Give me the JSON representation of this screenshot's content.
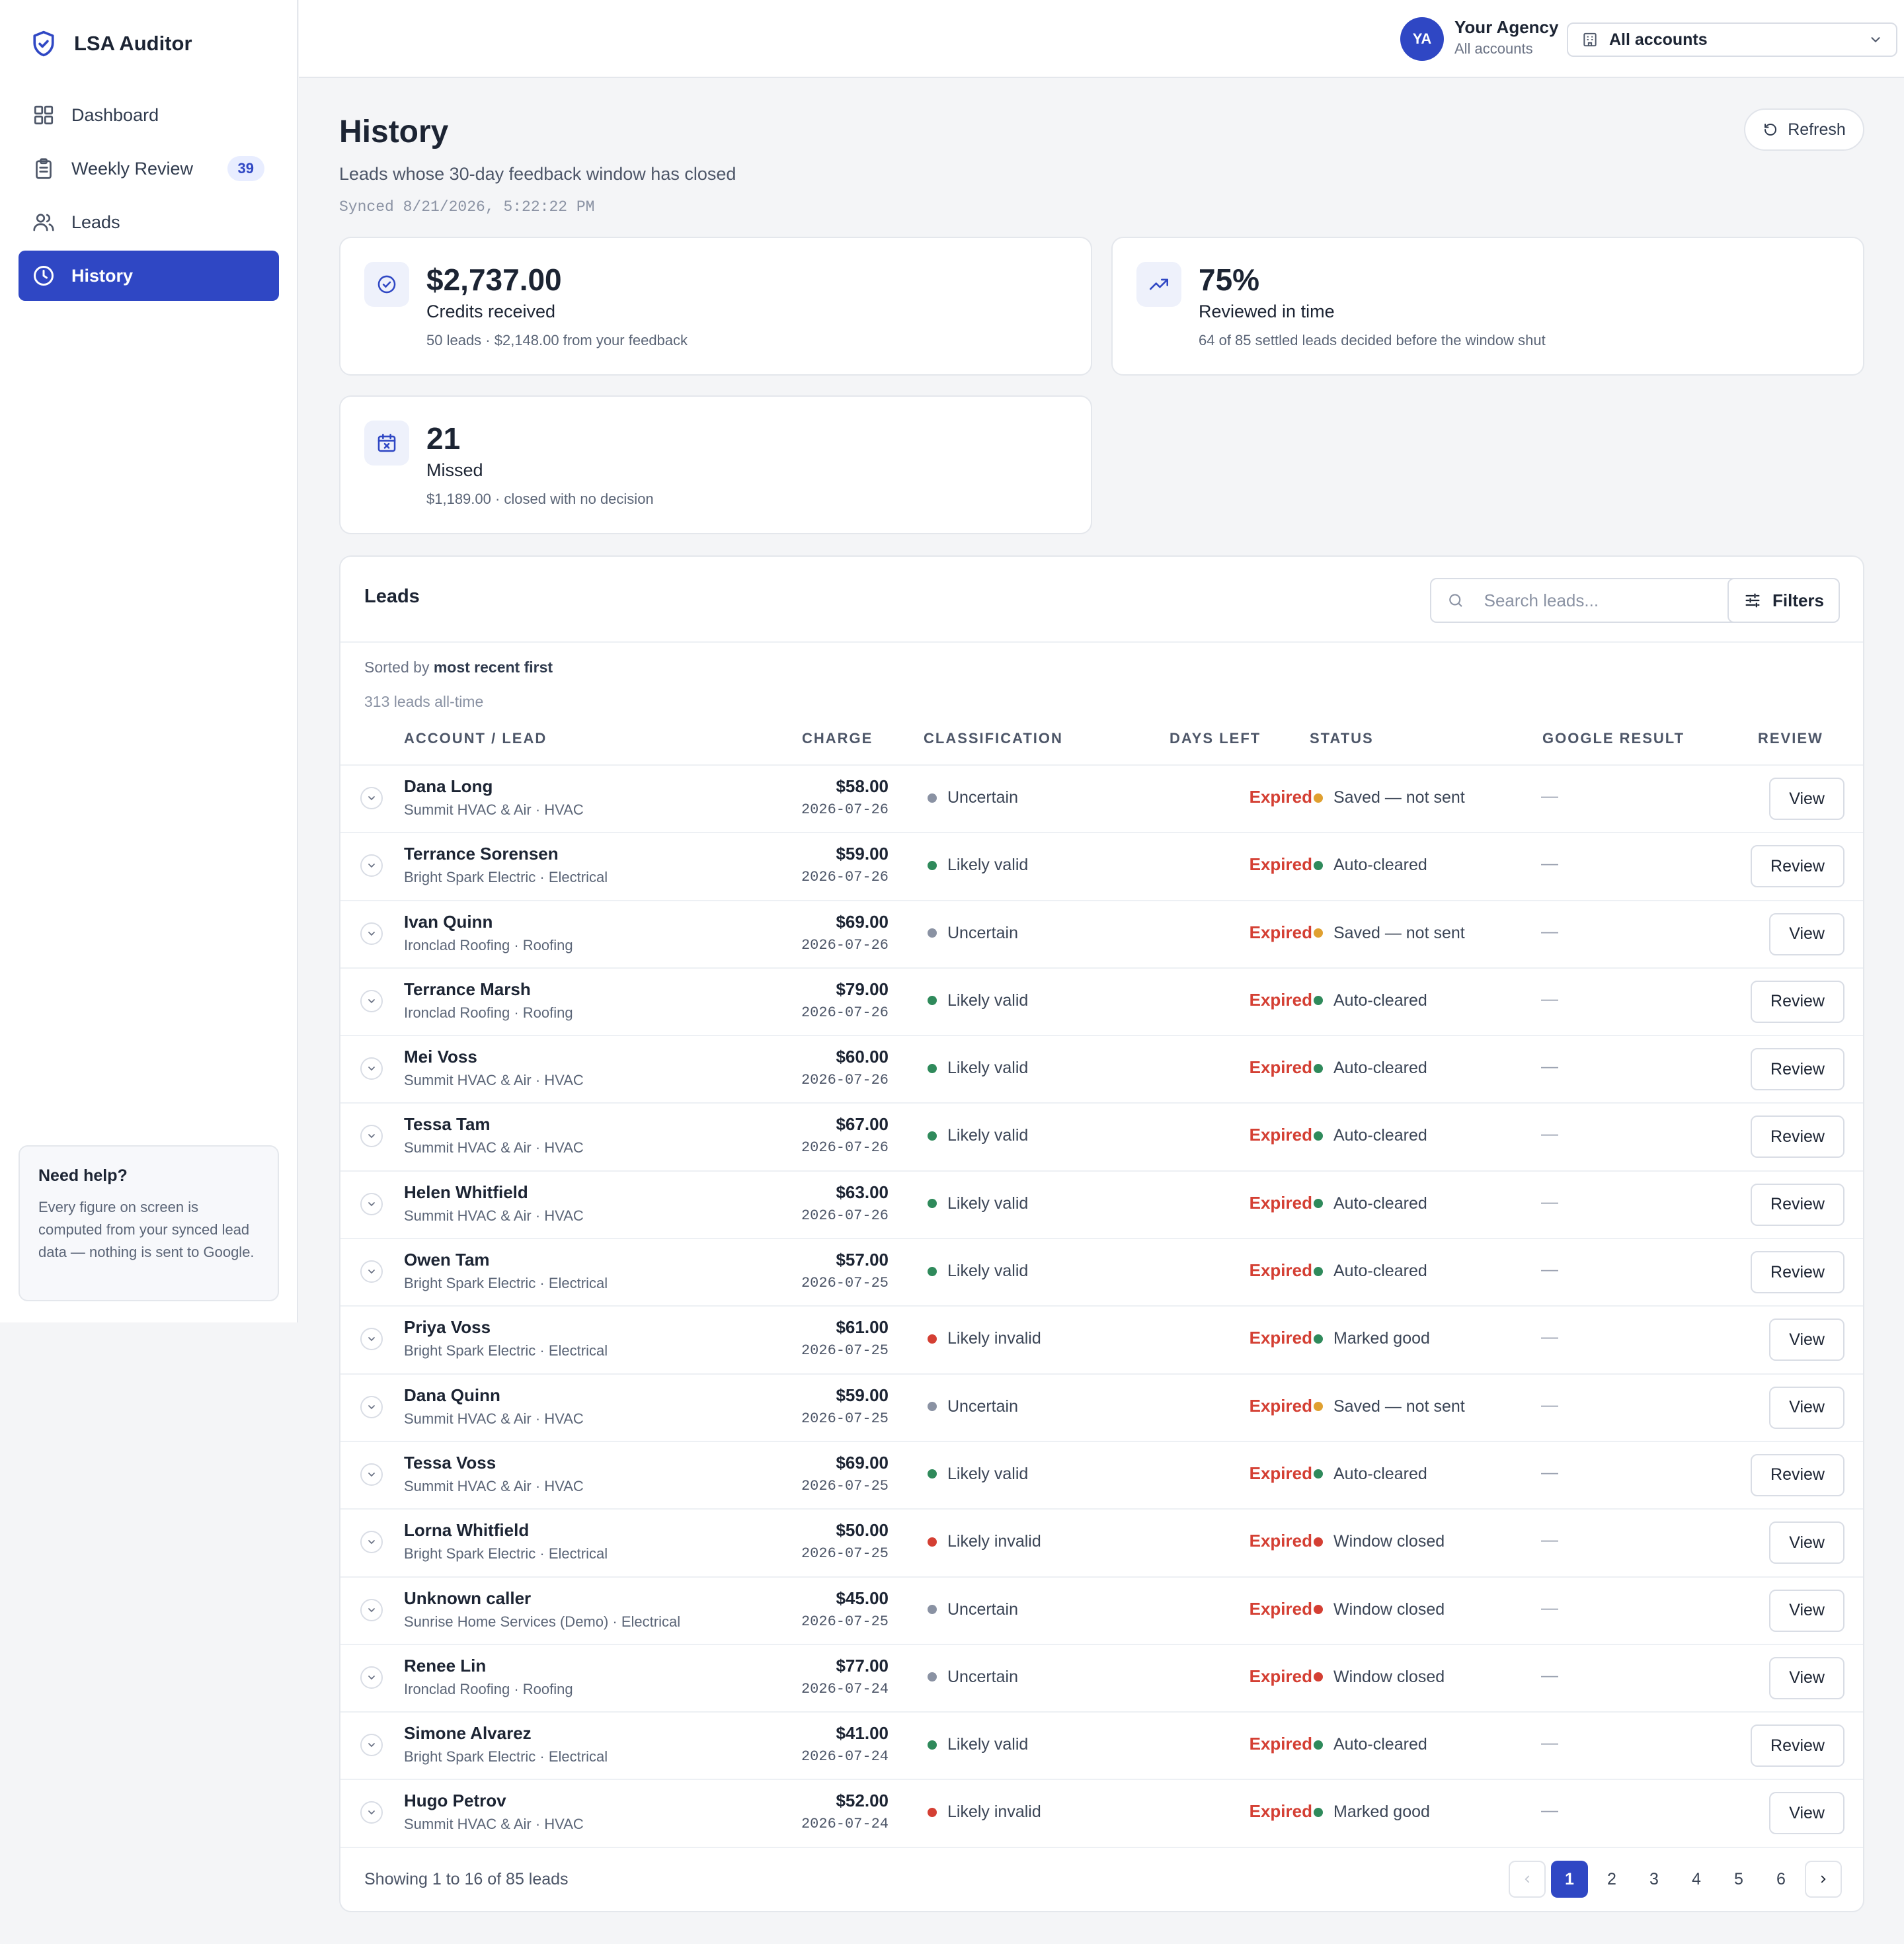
{
  "app": {
    "name": "LSA Auditor"
  },
  "sidebar": {
    "items": [
      {
        "label": "Dashboard",
        "icon": "grid-icon"
      },
      {
        "label": "Weekly Review",
        "icon": "clipboard-icon",
        "badge": "39"
      },
      {
        "label": "Leads",
        "icon": "users-icon"
      },
      {
        "label": "History",
        "icon": "clock-icon",
        "active": true
      }
    ],
    "help": {
      "title": "Need help?",
      "text": "Every figure on screen is computed from your synced lead data — nothing is sent to Google."
    }
  },
  "topbar": {
    "avatar_initials": "YA",
    "agency_name": "Your Agency",
    "agency_scope": "All accounts",
    "account_select": "All accounts"
  },
  "header": {
    "title": "History",
    "subtitle": "Leads whose 30-day feedback window has closed",
    "synced": "Synced 8/21/2026, 5:22:22 PM",
    "refresh_label": "Refresh"
  },
  "stats": [
    {
      "value": "$2,737.00",
      "label": "Credits received",
      "detail": "50 leads · $2,148.00 from your feedback",
      "icon": "check-circle-icon"
    },
    {
      "value": "75%",
      "label": "Reviewed in time",
      "detail": "64 of 85 settled leads decided before the window shut",
      "icon": "trending-up-icon"
    },
    {
      "value": "21",
      "label": "Missed",
      "detail": "$1,189.00 · closed with no decision",
      "icon": "calendar-x-icon"
    }
  ],
  "leads_panel": {
    "title": "Leads",
    "search_placeholder": "Search leads...",
    "filters_label": "Filters",
    "sorted_prefix": "Sorted by",
    "sorted_value": "most recent first",
    "alltime": "313 leads all-time",
    "columns": [
      "ACCOUNT / LEAD",
      "CHARGE",
      "CLASSIFICATION",
      "DAYS LEFT",
      "STATUS",
      "GOOGLE RESULT",
      "REVIEW"
    ],
    "rows": [
      {
        "name": "Dana Long",
        "account": "Summit HVAC & Air · HVAC",
        "charge": "$58.00",
        "date": "2026-07-26",
        "classification": "Uncertain",
        "days_left": "Expired",
        "status": "Saved — not sent",
        "google_result": "—",
        "action": "View"
      },
      {
        "name": "Terrance Sorensen",
        "account": "Bright Spark Electric · Electrical",
        "charge": "$59.00",
        "date": "2026-07-26",
        "classification": "Likely valid",
        "days_left": "Expired",
        "status": "Auto-cleared",
        "google_result": "—",
        "action": "Review"
      },
      {
        "name": "Ivan Quinn",
        "account": "Ironclad Roofing · Roofing",
        "charge": "$69.00",
        "date": "2026-07-26",
        "classification": "Uncertain",
        "days_left": "Expired",
        "status": "Saved — not sent",
        "google_result": "—",
        "action": "View"
      },
      {
        "name": "Terrance Marsh",
        "account": "Ironclad Roofing · Roofing",
        "charge": "$79.00",
        "date": "2026-07-26",
        "classification": "Likely valid",
        "days_left": "Expired",
        "status": "Auto-cleared",
        "google_result": "—",
        "action": "Review"
      },
      {
        "name": "Mei Voss",
        "account": "Summit HVAC & Air · HVAC",
        "charge": "$60.00",
        "date": "2026-07-26",
        "classification": "Likely valid",
        "days_left": "Expired",
        "status": "Auto-cleared",
        "google_result": "—",
        "action": "Review"
      },
      {
        "name": "Tessa Tam",
        "account": "Summit HVAC & Air · HVAC",
        "charge": "$67.00",
        "date": "2026-07-26",
        "classification": "Likely valid",
        "days_left": "Expired",
        "status": "Auto-cleared",
        "google_result": "—",
        "action": "Review"
      },
      {
        "name": "Helen Whitfield",
        "account": "Summit HVAC & Air · HVAC",
        "charge": "$63.00",
        "date": "2026-07-26",
        "classification": "Likely valid",
        "days_left": "Expired",
        "status": "Auto-cleared",
        "google_result": "—",
        "action": "Review"
      },
      {
        "name": "Owen Tam",
        "account": "Bright Spark Electric · Electrical",
        "charge": "$57.00",
        "date": "2026-07-25",
        "classification": "Likely valid",
        "days_left": "Expired",
        "status": "Auto-cleared",
        "google_result": "—",
        "action": "Review"
      },
      {
        "name": "Priya Voss",
        "account": "Bright Spark Electric · Electrical",
        "charge": "$61.00",
        "date": "2026-07-25",
        "classification": "Likely invalid",
        "days_left": "Expired",
        "status": "Marked good",
        "google_result": "—",
        "action": "View"
      },
      {
        "name": "Dana Quinn",
        "account": "Summit HVAC & Air · HVAC",
        "charge": "$59.00",
        "date": "2026-07-25",
        "classification": "Uncertain",
        "days_left": "Expired",
        "status": "Saved — not sent",
        "google_result": "—",
        "action": "View"
      },
      {
        "name": "Tessa Voss",
        "account": "Summit HVAC & Air · HVAC",
        "charge": "$69.00",
        "date": "2026-07-25",
        "classification": "Likely valid",
        "days_left": "Expired",
        "status": "Auto-cleared",
        "google_result": "—",
        "action": "Review"
      },
      {
        "name": "Lorna Whitfield",
        "account": "Bright Spark Electric · Electrical",
        "charge": "$50.00",
        "date": "2026-07-25",
        "classification": "Likely invalid",
        "days_left": "Expired",
        "status": "Window closed",
        "google_result": "—",
        "action": "View"
      },
      {
        "name": "Unknown caller",
        "account": "Sunrise Home Services (Demo) · Electrical",
        "charge": "$45.00",
        "date": "2026-07-25",
        "classification": "Uncertain",
        "days_left": "Expired",
        "status": "Window closed",
        "google_result": "—",
        "action": "View"
      },
      {
        "name": "Renee Lin",
        "account": "Ironclad Roofing · Roofing",
        "charge": "$77.00",
        "date": "2026-07-24",
        "classification": "Uncertain",
        "days_left": "Expired",
        "status": "Window closed",
        "google_result": "—",
        "action": "View"
      },
      {
        "name": "Simone Alvarez",
        "account": "Bright Spark Electric · Electrical",
        "charge": "$41.00",
        "date": "2026-07-24",
        "classification": "Likely valid",
        "days_left": "Expired",
        "status": "Auto-cleared",
        "google_result": "—",
        "action": "Review"
      },
      {
        "name": "Hugo Petrov",
        "account": "Summit HVAC & Air · HVAC",
        "charge": "$52.00",
        "date": "2026-07-24",
        "classification": "Likely invalid",
        "days_left": "Expired",
        "status": "Marked good",
        "google_result": "—",
        "action": "View"
      }
    ],
    "footer": {
      "showing": "Showing 1 to 16 of 85 leads",
      "pages": [
        "1",
        "2",
        "3",
        "4",
        "5",
        "6"
      ],
      "current_page": "1"
    }
  },
  "colors": {
    "accent": "#2f47c4",
    "expired": "#d43f33",
    "dot_uncertain": "#8a92a3",
    "dot_valid": "#2f8a5b",
    "dot_invalid": "#d43f33",
    "dot_saved": "#e0a030",
    "dot_autocleared": "#2f8a5b",
    "dot_marked_good": "#2f8a5b",
    "dot_window_closed": "#d43f33"
  }
}
